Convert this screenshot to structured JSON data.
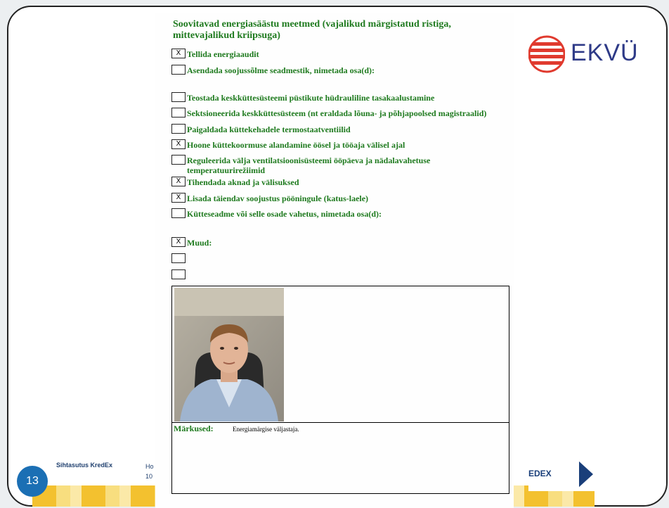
{
  "slide": {
    "number": "13",
    "footer_org": "Sihtasutus KredEx",
    "footer_addr_line1": "Ho",
    "footer_addr_line2": "10",
    "kredex_logo_text": "EDEX"
  },
  "logo": {
    "text": "EKVÜ",
    "stripe_color": "#e03a2e",
    "text_color": "#2e3a87"
  },
  "form": {
    "heading_line1": "Soovitavad energiasäästu meetmed (vajalikud märgistatud ristiga,",
    "heading_line2": "mittevajalikud kriipsuga)",
    "items": [
      {
        "mark": "X",
        "label": "Tellida energiaaudit"
      },
      {
        "mark": "",
        "label": "Asendada soojussõlme seadmestik, nimetada osa(d):"
      },
      {
        "mark": "",
        "label": "Teostada keskküttesüsteemi püstikute hüdrauliline tasakaalustamine"
      },
      {
        "mark": "",
        "label": "Sektsioneerida keskküttesüsteem (nt eraldada lõuna- ja põhjapoolsed magistraalid)"
      },
      {
        "mark": "",
        "label": "Paigaldada küttekehadele termostaatventiilid"
      },
      {
        "mark": "X",
        "label": "Hoone küttekoormuse alandamine öösel ja tööaja välisel ajal"
      },
      {
        "mark": "",
        "label": "Reguleerida välja ventilatsioonisüsteemi ööpäeva ja nädalavahetuse temperatuurirežiimid"
      },
      {
        "mark": "X",
        "label": "Tihendada aknad ja välisuksed"
      },
      {
        "mark": "X",
        "label": "Lisada täiendav soojustus pööningule (katus-laele)"
      },
      {
        "mark": "",
        "label": "Kütteseadme või selle osade vahetus, nimetada osa(d):"
      },
      {
        "mark": "X",
        "label": "Muud:"
      },
      {
        "mark": "",
        "label": ""
      },
      {
        "mark": "",
        "label": ""
      }
    ],
    "remarks_label": "Märkused:",
    "remarks_text": "Energiamärgise väljastaja."
  }
}
